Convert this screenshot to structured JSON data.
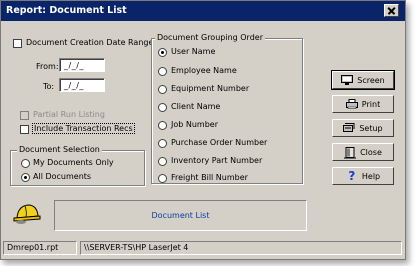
{
  "window": {
    "title": "Report: Document List"
  },
  "left": {
    "creation_date_range": "Document Creation Date Range",
    "from_label": "From:",
    "from_value": "_/_/_",
    "to_label": "To:",
    "to_value": "_/_/_",
    "partial_run": "Partial Run Listing",
    "include_transaction": "Include Transaction Recs",
    "selection_group": "Document Selection",
    "selection_options": [
      "My Documents Only",
      "All Documents"
    ],
    "selected_option": "All Documents"
  },
  "grouping": {
    "title": "Document Grouping Order",
    "options": [
      "User Name",
      "Employee Name",
      "Equipment Number",
      "Client Name",
      "Job Number",
      "Purchase Order Number",
      "Inventory Part Number",
      "Freight Bill Number"
    ],
    "selected": "User Name"
  },
  "buttons": {
    "screen": "Screen",
    "print": "Print",
    "setup": "Setup",
    "close": "Close",
    "help": "Help"
  },
  "report_panel": {
    "label": "Document List"
  },
  "status": {
    "file": "Dmrep01.rpt",
    "printer": "\\\\SERVER-TS\\HP LaserJet 4"
  },
  "icons": [
    "close-icon",
    "monitor-icon",
    "printer-icon",
    "setup-icon",
    "close-door-icon",
    "help-icon",
    "hardhat-icon"
  ],
  "colors": {
    "titlebar": "#0a246a",
    "face": "#d4d0c8",
    "link": "#0a3ca0"
  }
}
